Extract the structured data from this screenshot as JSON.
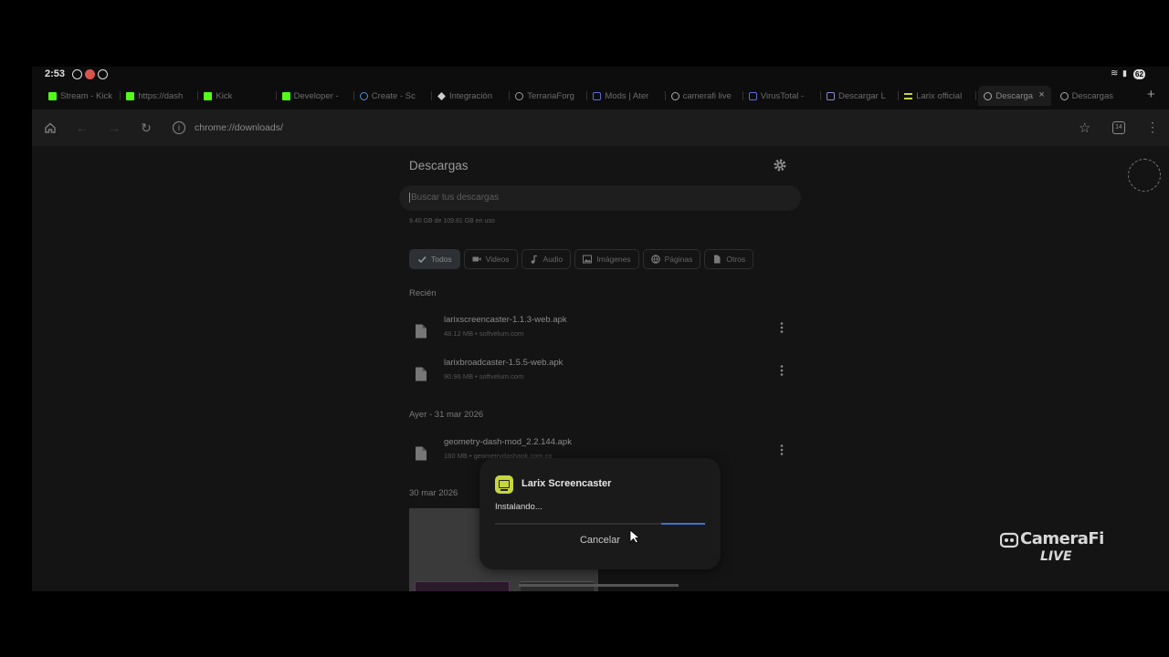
{
  "status_bar": {
    "time": "2:53",
    "battery": "62"
  },
  "tabs": [
    {
      "label": "Stream - Kick",
      "icon": "kick-icon",
      "color": "#53fc18"
    },
    {
      "label": "https://dash",
      "icon": "kick-icon",
      "color": "#53fc18"
    },
    {
      "label": "Kick",
      "icon": "kick-icon",
      "color": "#53fc18"
    },
    {
      "label": "Developer -",
      "icon": "kick-icon",
      "color": "#53fc18"
    },
    {
      "label": "Create - Sc",
      "icon": "globe-icon",
      "color": "#4a90d9"
    },
    {
      "label": "Integración",
      "icon": "diamond-icon",
      "color": "#cccccc"
    },
    {
      "label": "TerrariaForg",
      "icon": "globe-icon",
      "color": "#999999"
    },
    {
      "label": "Mods | Ater",
      "icon": "square-icon",
      "color": "#5b6cd8"
    },
    {
      "label": "camerafi live",
      "icon": "globe-icon",
      "color": "#aaaaaa"
    },
    {
      "label": "VirusTotal -",
      "icon": "square-icon",
      "color": "#5b6cd8"
    },
    {
      "label": "Descargar L",
      "icon": "square-icon",
      "color": "#8888cc"
    },
    {
      "label": "Larix official",
      "icon": "lines-icon",
      "color": "#c6d63c"
    },
    {
      "label": "Descarga",
      "icon": "globe-icon",
      "color": "#aaaaaa"
    },
    {
      "label": "Descargas",
      "icon": "globe-icon",
      "color": "#aaaaaa"
    }
  ],
  "toolbar": {
    "url": "chrome://downloads/",
    "tab_count": "14"
  },
  "downloads": {
    "title": "Descargas",
    "search_placeholder": "Buscar tus descargas",
    "storage": "9.40 GB de 109.81 GB en uso",
    "filters": [
      {
        "label": "Todos",
        "icon": "check-icon",
        "selected": true
      },
      {
        "label": "Videos",
        "icon": "video-icon",
        "selected": false
      },
      {
        "label": "Audio",
        "icon": "music-icon",
        "selected": false
      },
      {
        "label": "Imágenes",
        "icon": "image-icon",
        "selected": false
      },
      {
        "label": "Páginas",
        "icon": "globe-icon",
        "selected": false
      },
      {
        "label": "Otros",
        "icon": "file-icon",
        "selected": false
      }
    ],
    "groups": [
      {
        "heading": "Recién",
        "items": [
          {
            "name": "larixscreencaster-1.1.3-web.apk",
            "meta": "48.12 MB • softvelum.com"
          },
          {
            "name": "larixbroadcaster-1.5.5-web.apk",
            "meta": "90.96 MB • softvelum.com"
          }
        ]
      },
      {
        "heading": "Ayer - 31 mar 2026",
        "items": [
          {
            "name": "geometry-dash-mod_2.2.144.apk",
            "meta": "160 MB • geometrydashapk.com.co"
          }
        ]
      },
      {
        "heading": "30 mar 2026",
        "items": []
      }
    ]
  },
  "dialog": {
    "app_name": "Larix Screencaster",
    "status": "Instalando...",
    "cancel": "Cancelar",
    "progress_color": "#3f6fd0"
  },
  "overlay": {
    "brand": "CameraFi",
    "live": "LIVE"
  }
}
